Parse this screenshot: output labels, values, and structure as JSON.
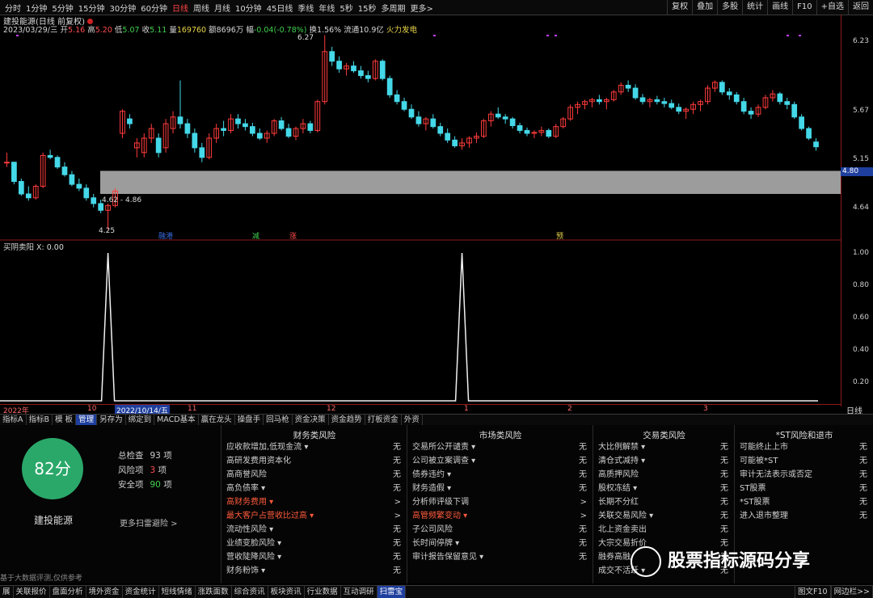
{
  "periods": [
    "分时",
    "1分钟",
    "5分钟",
    "15分钟",
    "30分钟",
    "60分钟",
    "日线",
    "周线",
    "月线",
    "10分钟",
    "45日线",
    "季线",
    "年线",
    "5秒",
    "15秒",
    "多周期",
    "更多>"
  ],
  "active_period_index": 6,
  "top_right": [
    "复权",
    "叠加",
    "多股",
    "统计",
    "画线",
    "F10",
    "+自选",
    "返回"
  ],
  "chart_title": "建投能源(日线 前复权)",
  "ohlc": {
    "date": "2023/03/29/三",
    "open_label": "开",
    "open": "5.16",
    "high_label": "高",
    "high": "5.20",
    "low_label": "低",
    "low": "5.07",
    "close_label": "收",
    "close": "5.11",
    "vol_label": "量",
    "vol": "169760",
    "amt_label": "额",
    "amt": "8696万",
    "chg_label": "幅",
    "chg": "-0.04(-0.78%)",
    "turn_label": "换",
    "turn": "1.56%",
    "float_label": "流通",
    "float": "10.9亿",
    "concept": "火力发电"
  },
  "price_axis": [
    "6.23",
    "5.67",
    "5.15",
    "4.64"
  ],
  "price_tag": "4.80",
  "annotations": {
    "high_mark": "6.27",
    "low_mark": "4.25",
    "range": "4.62 - 4.86"
  },
  "signals": [
    "融港",
    "减",
    "涨",
    "预"
  ],
  "sub_indicator": "买阴卖阳 X: 0.00",
  "sub_axis": [
    "1.00",
    "0.80",
    "0.60",
    "0.40",
    "0.20"
  ],
  "time_labels": [
    "2022年",
    "10",
    "2022/10/14/五",
    "11",
    "12",
    "1",
    "2",
    "3"
  ],
  "period_mode": "日线",
  "toolbar2": [
    "指标A",
    "指标B",
    "模 板",
    "管理",
    "另存为",
    "绑定到",
    "MACD基本",
    "赢在龙头",
    "操盘手",
    "回马枪",
    "资金决策",
    "资金趋势",
    "打板资金",
    "外资"
  ],
  "active_toolbar2_index": 3,
  "risk": {
    "score": "82分",
    "stock": "建投能源",
    "stats": [
      {
        "label": "总检查",
        "num": "93",
        "unit": "项"
      },
      {
        "label": "风险项",
        "num": "3",
        "unit": "项"
      },
      {
        "label": "安全项",
        "num": "90",
        "unit": "项"
      }
    ],
    "more": "更多扫雷避险 >",
    "columns": [
      {
        "title": "财务类风险",
        "items": [
          {
            "label": "应收款增加,低现金流 ▾",
            "value": "无",
            "hl": false
          },
          {
            "label": "高研发费用资本化",
            "value": "无",
            "hl": false
          },
          {
            "label": "高商誉风险",
            "value": "无",
            "hl": false
          },
          {
            "label": "高负债率 ▾",
            "value": "无",
            "hl": false
          },
          {
            "label": "高财务费用 ▾",
            "value": ">",
            "hl": true
          },
          {
            "label": "最大客户占营收比过高 ▾",
            "value": ">",
            "hl": true
          },
          {
            "label": "流动性风险 ▾",
            "value": "无",
            "hl": false
          },
          {
            "label": "业绩变脸风险 ▾",
            "value": "无",
            "hl": false
          },
          {
            "label": "营收陡降风险 ▾",
            "value": "无",
            "hl": false
          },
          {
            "label": "财务粉饰 ▾",
            "value": "无",
            "hl": false
          }
        ]
      },
      {
        "title": "市场类风险",
        "items": [
          {
            "label": "交易所公开谴责 ▾",
            "value": "无",
            "hl": false
          },
          {
            "label": "公司被立案调查 ▾",
            "value": "无",
            "hl": false
          },
          {
            "label": "债券违约 ▾",
            "value": "无",
            "hl": false
          },
          {
            "label": "财务造假 ▾",
            "value": "无",
            "hl": false
          },
          {
            "label": "分析师评级下调",
            "value": ">",
            "hl": false
          },
          {
            "label": "高管频繁变动 ▾",
            "value": ">",
            "hl": true
          },
          {
            "label": "子公司风险",
            "value": "无",
            "hl": false
          },
          {
            "label": "长时间停牌 ▾",
            "value": "无",
            "hl": false
          },
          {
            "label": "审计报告保留意见 ▾",
            "value": "无",
            "hl": false
          }
        ]
      },
      {
        "title": "交易类风险",
        "items": [
          {
            "label": "大比例解禁 ▾",
            "value": "无",
            "hl": false
          },
          {
            "label": "清仓式减持 ▾",
            "value": "无",
            "hl": false
          },
          {
            "label": "高质押风险",
            "value": "无",
            "hl": false
          },
          {
            "label": "股权冻结 ▾",
            "value": "无",
            "hl": false
          },
          {
            "label": "长期不分红",
            "value": "无",
            "hl": false
          },
          {
            "label": "关联交易风险 ▾",
            "value": "无",
            "hl": false
          },
          {
            "label": "北上资金卖出",
            "value": "无",
            "hl": false
          },
          {
            "label": "大宗交易折价",
            "value": "无",
            "hl": false
          },
          {
            "label": "融券高融",
            "value": "无",
            "hl": false
          },
          {
            "label": "成交不活跃 ▾",
            "value": "无",
            "hl": false
          }
        ]
      },
      {
        "title": "*ST风险和退市",
        "items": [
          {
            "label": "可能终止上市",
            "value": "无",
            "hl": false
          },
          {
            "label": "可能被*ST",
            "value": "无",
            "hl": false
          },
          {
            "label": "审计无法表示或否定",
            "value": "无",
            "hl": false
          },
          {
            "label": "ST股票",
            "value": "无",
            "hl": false
          },
          {
            "label": "*ST股票",
            "value": "无",
            "hl": false
          },
          {
            "label": "进入退市整理",
            "value": "无",
            "hl": false
          }
        ]
      }
    ]
  },
  "disclaimer": "基于大数据评测,仅供参考",
  "watermark": "股票指标源码分享",
  "bottombar": [
    "展",
    "关联报价",
    "盘面分析",
    "境外资金",
    "资金统计",
    "短线情绪",
    "涨跌面数",
    "综合资讯",
    "板块资讯",
    "行业数据",
    "互动调研",
    "扫雷宝"
  ],
  "active_bottom_index": 11,
  "bottom_right": [
    "图文F10",
    "网边栏>>"
  ],
  "chart_data": {
    "type": "candlestick",
    "y_axis_ticks": [
      6.23,
      5.67,
      5.15,
      4.64
    ],
    "ylim": [
      4.2,
      6.3
    ],
    "support_band": [
      4.62,
      4.86
    ],
    "candles": [
      [
        4.95,
        5.05,
        4.9,
        4.95
      ],
      [
        4.95,
        4.95,
        4.72,
        4.75
      ],
      [
        4.75,
        4.78,
        4.6,
        4.62
      ],
      [
        4.62,
        4.7,
        4.55,
        4.58
      ],
      [
        4.58,
        4.72,
        4.56,
        4.7
      ],
      [
        4.7,
        5.05,
        4.68,
        5.02
      ],
      [
        5.02,
        5.08,
        4.98,
        5.0
      ],
      [
        5.0,
        5.02,
        4.88,
        4.9
      ],
      [
        4.9,
        4.95,
        4.8,
        4.82
      ],
      [
        4.82,
        4.86,
        4.7,
        4.72
      ],
      [
        4.72,
        4.78,
        4.65,
        4.68
      ],
      [
        4.68,
        4.72,
        4.55,
        4.58
      ],
      [
        4.58,
        4.62,
        4.48,
        4.52
      ],
      [
        4.52,
        4.56,
        4.42,
        4.45
      ],
      [
        4.45,
        4.52,
        4.25,
        4.5
      ],
      [
        4.5,
        4.68,
        4.48,
        4.65
      ],
      [
        5.25,
        5.5,
        5.2,
        5.48
      ],
      [
        5.4,
        5.45,
        5.3,
        5.35
      ],
      [
        5.1,
        5.2,
        5.0,
        5.15
      ],
      [
        5.05,
        5.25,
        5.0,
        5.2
      ],
      [
        5.2,
        5.35,
        5.15,
        5.3
      ],
      [
        5.2,
        5.25,
        5.0,
        5.05
      ],
      [
        5.1,
        5.4,
        5.05,
        5.35
      ],
      [
        5.3,
        5.48,
        5.25,
        5.42
      ],
      [
        5.42,
        5.8,
        5.3,
        5.35
      ],
      [
        5.35,
        5.4,
        5.2,
        5.25
      ],
      [
        5.25,
        5.3,
        5.05,
        5.1
      ],
      [
        5.1,
        5.15,
        4.95,
        5.0
      ],
      [
        5.0,
        5.25,
        4.98,
        5.2
      ],
      [
        5.2,
        5.35,
        5.15,
        5.3
      ],
      [
        5.3,
        5.38,
        5.22,
        5.28
      ],
      [
        5.28,
        5.45,
        5.25,
        5.4
      ],
      [
        5.4,
        5.45,
        5.3,
        5.35
      ],
      [
        5.35,
        5.4,
        5.28,
        5.32
      ],
      [
        5.32,
        5.36,
        5.22,
        5.25
      ],
      [
        5.25,
        5.3,
        5.18,
        5.2
      ],
      [
        5.2,
        5.28,
        5.15,
        5.25
      ],
      [
        5.25,
        5.4,
        5.22,
        5.38
      ],
      [
        5.38,
        5.42,
        5.28,
        5.3
      ],
      [
        5.3,
        5.35,
        5.2,
        5.22
      ],
      [
        5.22,
        5.32,
        5.18,
        5.3
      ],
      [
        5.3,
        5.4,
        5.25,
        5.35
      ],
      [
        5.35,
        5.38,
        5.25,
        5.28
      ],
      [
        5.28,
        5.6,
        5.26,
        5.58
      ],
      [
        5.58,
        6.27,
        5.55,
        6.1
      ],
      [
        6.1,
        6.15,
        5.95,
        6.0
      ],
      [
        6.0,
        6.05,
        5.88,
        5.92
      ],
      [
        5.92,
        5.98,
        5.85,
        5.95
      ],
      [
        5.95,
        6.0,
        5.88,
        5.9
      ],
      [
        5.9,
        5.95,
        5.82,
        5.85
      ],
      [
        5.85,
        5.9,
        5.78,
        5.82
      ],
      [
        5.82,
        6.02,
        5.8,
        6.0
      ],
      [
        6.0,
        6.02,
        5.8,
        5.82
      ],
      [
        5.82,
        5.85,
        5.62,
        5.65
      ],
      [
        5.65,
        5.7,
        5.55,
        5.58
      ],
      [
        5.58,
        5.62,
        5.48,
        5.5
      ],
      [
        5.5,
        5.55,
        5.4,
        5.42
      ],
      [
        5.42,
        5.48,
        5.32,
        5.35
      ],
      [
        5.35,
        5.42,
        5.28,
        5.4
      ],
      [
        5.4,
        5.45,
        5.3,
        5.32
      ],
      [
        5.32,
        5.36,
        5.22,
        5.25
      ],
      [
        5.25,
        5.3,
        5.15,
        5.18
      ],
      [
        5.18,
        5.22,
        5.1,
        5.12
      ],
      [
        5.12,
        5.2,
        5.08,
        5.15
      ],
      [
        5.15,
        5.22,
        5.1,
        5.2
      ],
      [
        5.2,
        5.26,
        5.15,
        5.22
      ],
      [
        5.22,
        5.4,
        5.2,
        5.38
      ],
      [
        5.38,
        5.48,
        5.32,
        5.45
      ],
      [
        5.45,
        5.52,
        5.4,
        5.42
      ],
      [
        5.42,
        5.45,
        5.35,
        5.4
      ],
      [
        5.4,
        5.42,
        5.3,
        5.33
      ],
      [
        5.33,
        5.36,
        5.25,
        5.28
      ],
      [
        5.28,
        5.31,
        5.22,
        5.25
      ],
      [
        5.25,
        5.28,
        5.2,
        5.26
      ],
      [
        5.26,
        5.32,
        5.22,
        5.28
      ],
      [
        5.28,
        5.3,
        5.2,
        5.22
      ],
      [
        5.22,
        5.35,
        5.2,
        5.32
      ],
      [
        5.32,
        5.42,
        5.3,
        5.4
      ],
      [
        5.4,
        5.55,
        5.38,
        5.52
      ],
      [
        5.52,
        5.58,
        5.45,
        5.55
      ],
      [
        5.55,
        5.6,
        5.5,
        5.58
      ],
      [
        5.58,
        5.62,
        5.52,
        5.6
      ],
      [
        5.6,
        5.65,
        5.55,
        5.58
      ],
      [
        5.58,
        5.62,
        5.5,
        5.6
      ],
      [
        5.6,
        5.7,
        5.58,
        5.68
      ],
      [
        5.68,
        5.78,
        5.65,
        5.75
      ],
      [
        5.75,
        5.8,
        5.68,
        5.72
      ],
      [
        5.72,
        5.76,
        5.6,
        5.62
      ],
      [
        5.62,
        5.66,
        5.55,
        5.58
      ],
      [
        5.58,
        5.62,
        5.52,
        5.6
      ],
      [
        5.6,
        5.64,
        5.55,
        5.58
      ],
      [
        5.58,
        5.62,
        5.52,
        5.56
      ],
      [
        5.56,
        5.6,
        5.5,
        5.52
      ],
      [
        5.52,
        5.56,
        5.45,
        5.48
      ],
      [
        5.48,
        5.52,
        5.4,
        5.5
      ],
      [
        5.5,
        5.58,
        5.45,
        5.55
      ],
      [
        5.55,
        5.6,
        5.48,
        5.58
      ],
      [
        5.58,
        5.75,
        5.55,
        5.72
      ],
      [
        5.72,
        5.8,
        5.68,
        5.78
      ],
      [
        5.78,
        5.8,
        5.65,
        5.68
      ],
      [
        5.68,
        5.72,
        5.6,
        5.65
      ],
      [
        5.65,
        5.68,
        5.55,
        5.58
      ],
      [
        5.58,
        5.62,
        5.45,
        5.48
      ],
      [
        5.48,
        5.52,
        5.4,
        5.45
      ],
      [
        5.45,
        5.55,
        5.42,
        5.52
      ],
      [
        5.52,
        5.65,
        5.5,
        5.62
      ],
      [
        5.62,
        5.7,
        5.58,
        5.66
      ],
      [
        5.66,
        5.68,
        5.55,
        5.58
      ],
      [
        5.58,
        5.62,
        5.5,
        5.55
      ],
      [
        5.55,
        5.58,
        5.4,
        5.42
      ],
      [
        5.42,
        5.45,
        5.28,
        5.3
      ],
      [
        5.3,
        5.32,
        5.18,
        5.2
      ],
      [
        5.16,
        5.2,
        5.07,
        5.11
      ]
    ],
    "signal_series": {
      "name": "买阴卖阳",
      "peaks_at_index": [
        14,
        63
      ],
      "ylim": [
        0,
        1
      ]
    }
  }
}
